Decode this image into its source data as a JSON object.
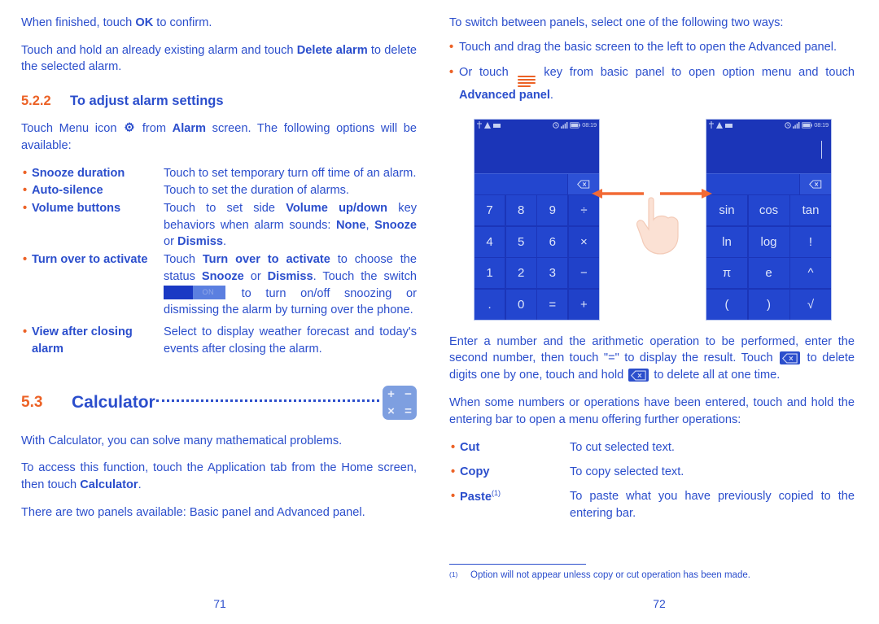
{
  "document": {
    "left_page_number": "71",
    "right_page_number": "72",
    "accent_blue": "#2b4ecc",
    "accent_orange": "#ec6226"
  },
  "left": {
    "para_ok": "When finished, touch OK to confirm.",
    "para_ok_parts": {
      "a": "When finished, touch ",
      "b": "OK",
      "c": " to confirm."
    },
    "para_delete_parts": {
      "a": "Touch and hold an already existing alarm and touch ",
      "b": "Delete alarm",
      "c": " to delete the selected alarm."
    },
    "section": {
      "number": "5.2.2",
      "title": "To adjust alarm settings"
    },
    "para_menu_parts": {
      "a": "Touch Menu icon ",
      "icon": "gear-icon",
      "b": " from ",
      "c": "Alarm",
      "d": " screen. The following options will be available:"
    },
    "options": [
      {
        "term": "Snooze duration",
        "desc": "Touch to set temporary turn off time of an alarm."
      },
      {
        "term": "Auto-silence",
        "desc": "Touch to set the duration of alarms."
      },
      {
        "term": "Volume buttons",
        "desc_parts": {
          "a": "Touch to set side ",
          "b": "Volume up/down",
          "c": " key behaviors when alarm sounds: ",
          "d": "None",
          "e": ", ",
          "f": "Snooze",
          "g": " or ",
          "h": "Dismiss",
          "i": "."
        }
      },
      {
        "term": "Turn over to activate",
        "desc_parts": {
          "a": "Touch ",
          "b": "Turn over to activate",
          "c": " to choose the status ",
          "d": "Snooze",
          "e": " or ",
          "f": "Dismiss",
          "g": ". Touch the switch ",
          "toggle_label": "ON",
          "h": " to turn on/off snoozing or dismissing the alarm by turning over the phone."
        }
      },
      {
        "term": "View after closing alarm",
        "desc": "Select to display weather forecast and today's events after closing the alarm."
      }
    ],
    "calculator_heading": {
      "number": "5.3",
      "title": "Calculator"
    },
    "calculator_icon_symbols": [
      "+",
      "−",
      "×",
      "="
    ],
    "para_with_calc": "With Calculator, you can solve many mathematical problems.",
    "para_access_parts": {
      "a": "To access this function, touch the Application tab from the Home screen, then touch ",
      "b": "Calculator",
      "c": "."
    },
    "para_two_panels": "There are two panels available: Basic panel and Advanced panel."
  },
  "right": {
    "para_switch": "To switch between panels, select one of the following two ways:",
    "bullets": [
      {
        "text": "Touch and drag the basic screen to the left to open the Advanced panel."
      },
      {
        "parts": {
          "a": "Or touch ",
          "icon": "hamburger-menu-icon",
          "b": " key from basic panel to open option menu and touch ",
          "c": "Advanced panel",
          "d": "."
        }
      }
    ],
    "phones": {
      "basic": {
        "status": {
          "time": "08:19"
        },
        "delete_icon": "backspace-icon",
        "keys": [
          "7",
          "8",
          "9",
          "÷",
          "4",
          "5",
          "6",
          "×",
          "1",
          "2",
          "3",
          "−",
          ".",
          "0",
          "=",
          "+"
        ]
      },
      "advanced": {
        "status": {
          "time": "08:19"
        },
        "delete_icon": "backspace-icon",
        "keys": [
          "sin",
          "cos",
          "tan",
          "ln",
          "log",
          "!",
          "π",
          "e",
          "^",
          "(",
          ")",
          "√"
        ]
      },
      "gesture": "swipe-left-right-hand-gesture"
    },
    "para_enter_parts": {
      "a": "Enter a number and the arithmetic operation to be performed, enter the second number, then touch \"=\" to display the result. Touch ",
      "icon1": "backspace-icon",
      "b": " to delete digits one by one, touch and hold ",
      "icon2": "backspace-icon",
      "c": " to delete all at one time."
    },
    "para_hold": "When some numbers or operations have been entered, touch and hold the entering bar to open a menu offering further operations:",
    "operations": [
      {
        "term": "Cut",
        "sup": "",
        "desc": "To cut selected text."
      },
      {
        "term": "Copy",
        "sup": "",
        "desc": "To copy selected text."
      },
      {
        "term": "Paste",
        "sup": "(1)",
        "desc": "To paste what you have previously copied to the entering bar."
      }
    ],
    "footnote": {
      "marker": "(1)",
      "text": "Option will not appear unless copy or cut operation has been made."
    }
  }
}
